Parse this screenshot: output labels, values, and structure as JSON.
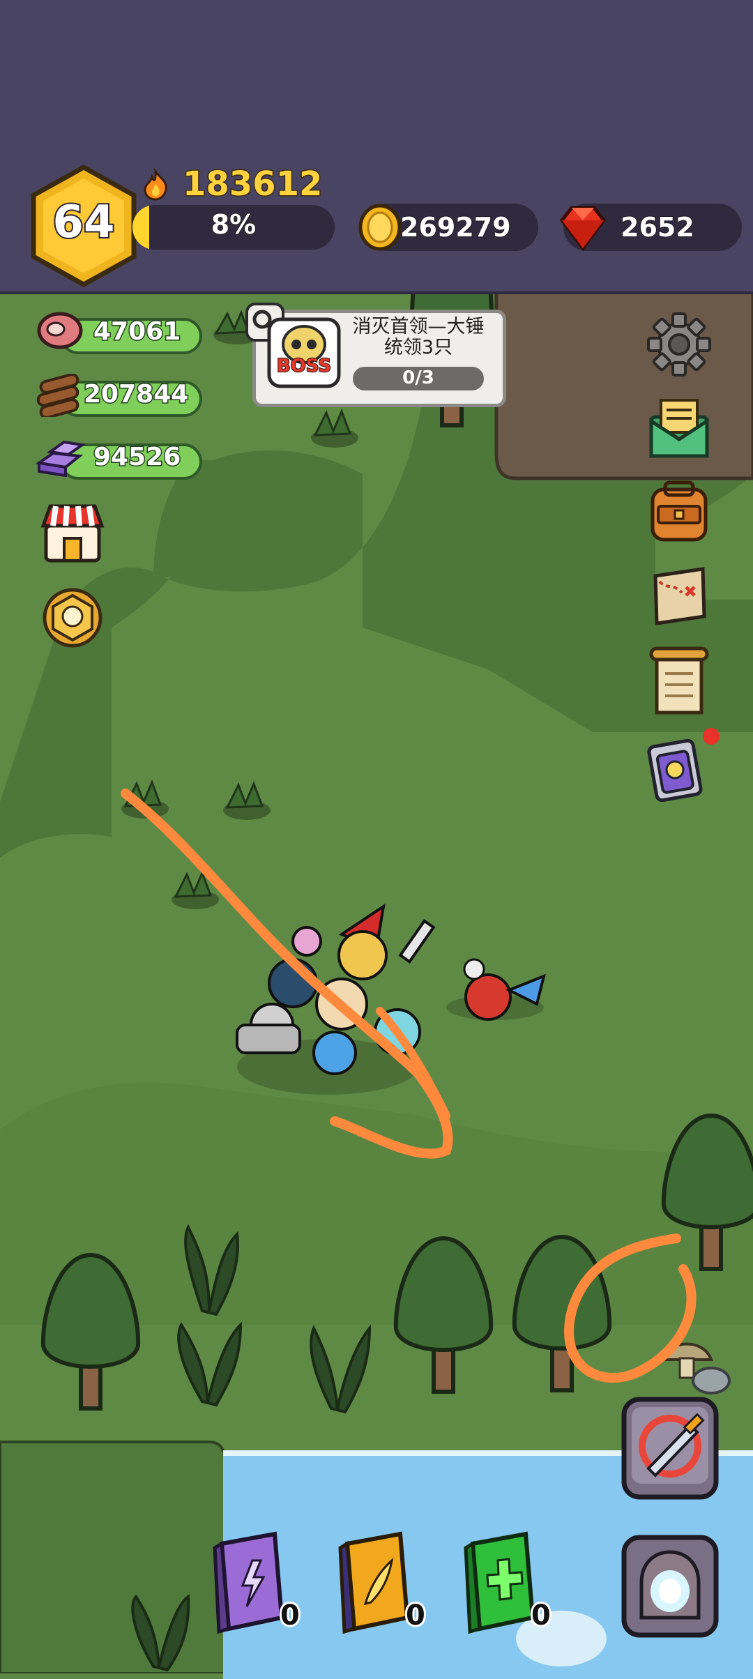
{
  "player": {
    "level": "64",
    "power": "183612",
    "exp_percent_label": "8%",
    "exp_fraction": 0.08
  },
  "currencies": {
    "gold": "269279",
    "gems": "2652"
  },
  "resources": {
    "meat": "47061",
    "wood": "207844",
    "crystal": "94526"
  },
  "quest": {
    "title": "消灭首领—大锤统领3只",
    "progress": "0/3",
    "badge": "BOSS"
  },
  "skill_books": [
    {
      "name": "lightning-book",
      "count": "0",
      "color": "#9b6bd6"
    },
    {
      "name": "feather-book",
      "count": "0",
      "color": "#f2a81c"
    },
    {
      "name": "heal-book",
      "count": "0",
      "color": "#2fbf3a"
    }
  ],
  "icons": {
    "settings": "gear-icon",
    "mail": "mail-icon",
    "backpack": "backpack-icon",
    "map": "treasure-map-icon",
    "scroll": "scroll-icon",
    "potion": "skull-potion-icon",
    "shop": "shop-icon",
    "trophy": "trophy-badge-icon",
    "battle": "crossed-sword-icon",
    "portal": "portal-icon"
  },
  "colors": {
    "topbar": "#4a4463",
    "grass_light": "#6a9a4e",
    "grass_dark": "#4f7a3c",
    "water": "#86c8ef",
    "annotation": "#ff8a3d"
  }
}
